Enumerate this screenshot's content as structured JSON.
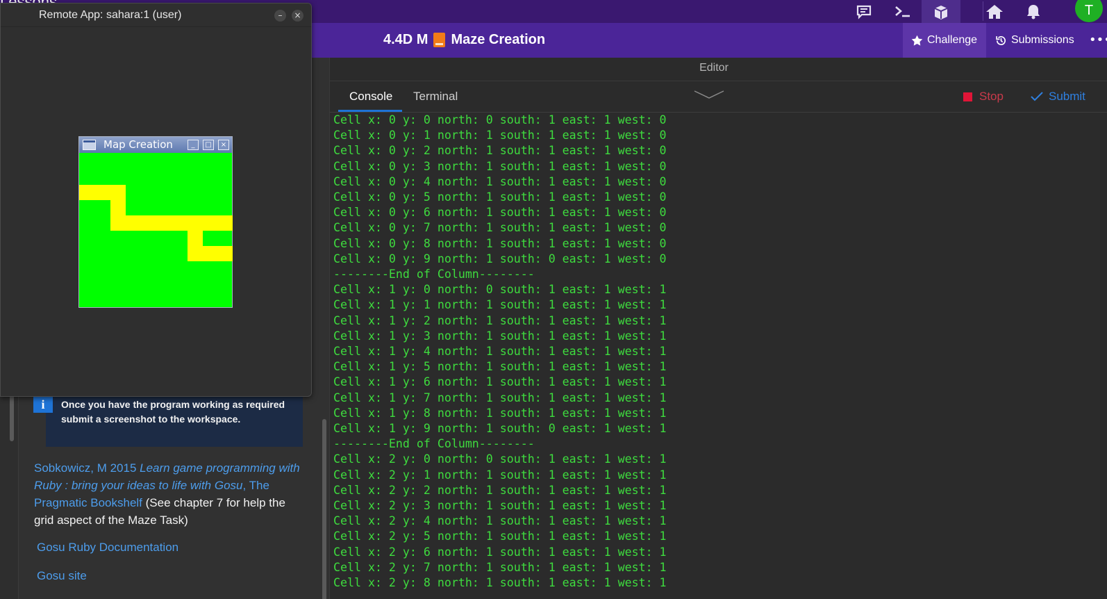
{
  "topbar": {
    "section_title": "Lessons",
    "icons": [
      "chat-icon",
      "terminal-icon",
      "lesson-book-icon",
      "home-icon",
      "bell-icon"
    ],
    "avatar_letter": "T"
  },
  "course": {
    "code": "4.4D M",
    "title": "Maze Creation",
    "buttons": {
      "challenge": "Challenge",
      "submissions": "Submissions",
      "more": "•••"
    }
  },
  "remote_app": {
    "title": "Remote App: sahara:1 (user)",
    "minimize": "–",
    "close": "×",
    "map_window": {
      "title": "Map Creation"
    }
  },
  "lesson": {
    "info_text": "Once you have the program working as required submit a screenshot to the workspace.",
    "reference": {
      "author": "Sobkowicz, M 2015 ",
      "book_title": "Learn game programming with Ruby : bring your ideas to life with Gosu",
      "publisher": ", The Pragmatic Bookshelf",
      "note": " (See chapter 7 for help the grid aspect of the Maze Task)"
    },
    "links": [
      "Gosu Ruby Documentation",
      "Gosu site"
    ]
  },
  "editor": {
    "title": "Editor",
    "tabs": [
      "Console",
      "Terminal"
    ],
    "active_tab": "Console",
    "stop_label": "Stop",
    "submit_label": "Submit"
  },
  "console_lines": [
    "Cell x: 0 y: 0 north: 0 south: 1 east: 1 west: 0",
    "Cell x: 0 y: 1 north: 1 south: 1 east: 1 west: 0",
    "Cell x: 0 y: 2 north: 1 south: 1 east: 1 west: 0",
    "Cell x: 0 y: 3 north: 1 south: 1 east: 1 west: 0",
    "Cell x: 0 y: 4 north: 1 south: 1 east: 1 west: 0",
    "Cell x: 0 y: 5 north: 1 south: 1 east: 1 west: 0",
    "Cell x: 0 y: 6 north: 1 south: 1 east: 1 west: 0",
    "Cell x: 0 y: 7 north: 1 south: 1 east: 1 west: 0",
    "Cell x: 0 y: 8 north: 1 south: 1 east: 1 west: 0",
    "Cell x: 0 y: 9 north: 1 south: 0 east: 1 west: 0",
    "--------End of Column--------",
    "Cell x: 1 y: 0 north: 0 south: 1 east: 1 west: 1",
    "Cell x: 1 y: 1 north: 1 south: 1 east: 1 west: 1",
    "Cell x: 1 y: 2 north: 1 south: 1 east: 1 west: 1",
    "Cell x: 1 y: 3 north: 1 south: 1 east: 1 west: 1",
    "Cell x: 1 y: 4 north: 1 south: 1 east: 1 west: 1",
    "Cell x: 1 y: 5 north: 1 south: 1 east: 1 west: 1",
    "Cell x: 1 y: 6 north: 1 south: 1 east: 1 west: 1",
    "Cell x: 1 y: 7 north: 1 south: 1 east: 1 west: 1",
    "Cell x: 1 y: 8 north: 1 south: 1 east: 1 west: 1",
    "Cell x: 1 y: 9 north: 1 south: 0 east: 1 west: 1",
    "--------End of Column--------",
    "Cell x: 2 y: 0 north: 0 south: 1 east: 1 west: 1",
    "Cell x: 2 y: 1 north: 1 south: 1 east: 1 west: 1",
    "Cell x: 2 y: 2 north: 1 south: 1 east: 1 west: 1",
    "Cell x: 2 y: 3 north: 1 south: 1 east: 1 west: 1",
    "Cell x: 2 y: 4 north: 1 south: 1 east: 1 west: 1",
    "Cell x: 2 y: 5 north: 1 south: 1 east: 1 west: 1",
    "Cell x: 2 y: 6 north: 1 south: 1 east: 1 west: 1",
    "Cell x: 2 y: 7 north: 1 south: 1 east: 1 west: 1",
    "Cell x: 2 y: 8 north: 1 south: 1 east: 1 west: 1"
  ],
  "colors": {
    "topbar": "#3a1870",
    "titlebar": "#4b2598",
    "console_text": "#3edb3e",
    "maze_floor": "#00ff00",
    "maze_path": "#ffff00",
    "link": "#4d9dec",
    "stop": "#e01537",
    "submit": "#2f80e0"
  }
}
